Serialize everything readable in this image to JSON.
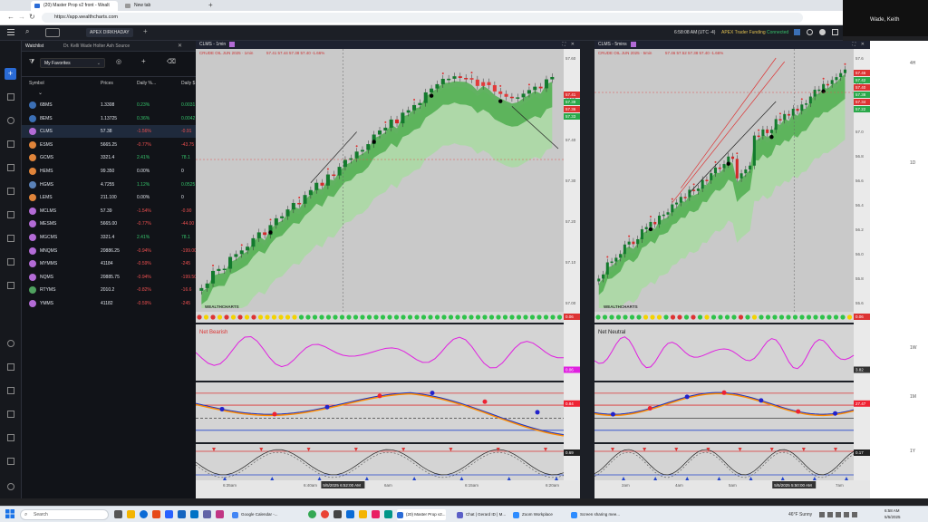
{
  "browser": {
    "tabs": [
      {
        "label": "(20) Master Prop v2 front - Wealt"
      },
      {
        "label": "New tab"
      }
    ],
    "url": "https://app.wealthcharts.com"
  },
  "zoom_user": "Wade, Keith",
  "app": {
    "account": "APEX DIRKHADAY",
    "time": "6:58:08 AM",
    "timezone": "(UTC -4)",
    "funding_label": "APEX Trader Funding",
    "status": "Connected"
  },
  "watchlist": {
    "title": "Watchlist",
    "tab2": "Dr. Kelli Wade Holter Ash Source",
    "list_name": "My Favorites",
    "columns": [
      "Symbol",
      "Prices",
      "Daily %...",
      "Daily $"
    ],
    "rows": [
      {
        "symbol": "6BMS",
        "price": "1.3308",
        "pct": "0.23%",
        "chg": "0.0031",
        "dir": "up",
        "color": "#3b6fb5"
      },
      {
        "symbol": "8EMS",
        "price": "1.13725",
        "pct": "0.36%",
        "chg": "0.0042",
        "dir": "up",
        "color": "#3b6fb5"
      },
      {
        "symbol": "CLMS",
        "price": "57.38",
        "pct": "-1.56%",
        "chg": "-0.91",
        "dir": "dn",
        "color": "#b36bd6"
      },
      {
        "symbol": "ESMS",
        "price": "5665.25",
        "pct": "-0.77%",
        "chg": "-43.75",
        "dir": "dn",
        "color": "#e0843a"
      },
      {
        "symbol": "GCMS",
        "price": "3321.4",
        "pct": "2.41%",
        "chg": "78.1",
        "dir": "up",
        "color": "#e0843a"
      },
      {
        "symbol": "HEMS",
        "price": "99.350",
        "pct": "0.00%",
        "chg": "0",
        "dir": "neu",
        "color": "#e0843a"
      },
      {
        "symbol": "HGMS",
        "price": "4.7255",
        "pct": "1.12%",
        "chg": "0.0525",
        "dir": "up",
        "color": "#5a82b8"
      },
      {
        "symbol": "LEMS",
        "price": "211.100",
        "pct": "0.00%",
        "chg": "0",
        "dir": "neu",
        "color": "#e0843a"
      },
      {
        "symbol": "MCLMS",
        "price": "57.39",
        "pct": "-1.54%",
        "chg": "-0.90",
        "dir": "dn",
        "color": "#b36bd6"
      },
      {
        "symbol": "MESMS",
        "price": "5665.00",
        "pct": "-0.77%",
        "chg": "-44.00",
        "dir": "dn",
        "color": "#b36bd6"
      },
      {
        "symbol": "MGCMS",
        "price": "3321.4",
        "pct": "2.41%",
        "chg": "78.1",
        "dir": "up",
        "color": "#b36bd6"
      },
      {
        "symbol": "MNQMS",
        "price": "20886.25",
        "pct": "-0.94%",
        "chg": "-199.00",
        "dir": "dn",
        "color": "#b36bd6"
      },
      {
        "symbol": "MYMMS",
        "price": "41184",
        "pct": "-0.59%",
        "chg": "-245",
        "dir": "dn",
        "color": "#b36bd6"
      },
      {
        "symbol": "NQMS",
        "price": "20885.75",
        "pct": "-0.94%",
        "chg": "-199.50",
        "dir": "dn",
        "color": "#b36bd6"
      },
      {
        "symbol": "RTYMS",
        "price": "2010.2",
        "pct": "-0.82%",
        "chg": "-16.6",
        "dir": "dn",
        "color": "#4fa15f"
      },
      {
        "symbol": "YMMS",
        "price": "41182",
        "pct": "-0.59%",
        "chg": "-245",
        "dir": "dn",
        "color": "#b36bd6"
      }
    ]
  },
  "charts": [
    {
      "tab": "CLMS - 1min",
      "legend": "CRUDE OIL JUN 2025 · 1min",
      "ohlc": "57.41  57.44  57.38  57.40  -1.66%",
      "indicator_label": "Net Bearish",
      "x_ticks": [
        "6:35am",
        "6:40am",
        "6am",
        "6:15am",
        "6:20am"
      ],
      "crosshair_time": "5/5/2025 6:52:00 AM",
      "price_ticks": [
        "57.60",
        "57.50",
        "57.40",
        "57.30",
        "57.20",
        "57.10",
        "57.00"
      ],
      "price_badges": [
        "57.41",
        "57.39",
        "57.36",
        "57.33"
      ],
      "osc_badges": [
        "0.06",
        "0.06",
        "0.84",
        "0.69"
      ],
      "wealth_label": "WEALTHCHARTS"
    },
    {
      "tab": "CLMS - 5mins",
      "legend": "CRUDE OIL JUN 2025 · 5min",
      "ohlc": "57.46  57.52  57.38  57.40  -1.66%",
      "indicator_label": "Net Neutral",
      "x_ticks": [
        "2am",
        "4am",
        "5am",
        "6am",
        "7am"
      ],
      "crosshair_time": "5/5/2025 5:50:00 AM",
      "price_ticks": [
        "57.6",
        "57.4",
        "57.2",
        "57.0",
        "56.8",
        "56.6",
        "56.4",
        "56.2",
        "56.0",
        "55.8",
        "55.6"
      ],
      "price_badges": [
        "57.46",
        "57.42",
        "57.40",
        "57.38",
        "57.34",
        "57.22"
      ],
      "osc_badges": [
        "0.06",
        "3.82",
        "27.47",
        "0.17"
      ],
      "wealth_label": "WEALTHCHARTS"
    }
  ],
  "right_axis_labels": [
    "4H",
    "1D",
    "1W",
    "1M",
    "1Y"
  ],
  "taskbar": {
    "search": "Search",
    "apps": [
      {
        "label": "Google Calendar -...",
        "color": "#4285f4"
      },
      {
        "label": "(20) Master Prop v2...",
        "color": "#2a6bd6"
      },
      {
        "label": "Chat | Gerard ID | M...",
        "color": "#5b5fc7"
      },
      {
        "label": "Zoom Workplace",
        "color": "#2d8cff"
      },
      {
        "label": "Screen sharing mee...",
        "color": "#2d8cff"
      }
    ],
    "weather": "46°F  Sunny",
    "time": "6:58 AM",
    "date": "5/5/2025"
  }
}
